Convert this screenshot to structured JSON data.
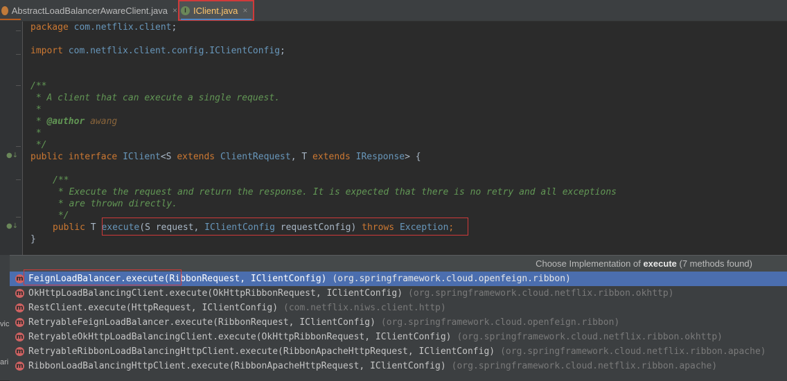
{
  "tabs": [
    {
      "label": "AbstractLoadBalancerAwareClient.java",
      "icon": "java-class-icon",
      "close": "×"
    },
    {
      "label": "IClient.java",
      "icon": "java-interface-icon",
      "icon_glyph": "I",
      "close": "×"
    }
  ],
  "code": {
    "l1_kw": "package",
    "l1_pkg": "com.netflix.client",
    "l1_end": ";",
    "l2_kw": "import",
    "l2_pkg": "com.netflix.client.config.IClientConfig",
    "l2_end": ";",
    "c1": "/**",
    "c2": " * A client that can execute a single request.",
    "c3": " *",
    "c4_star": " * ",
    "c4_tag": "@author",
    "c4_val": " awang",
    "c5": " *",
    "c6": " */",
    "i_public": "public",
    "i_interface": " interface ",
    "i_name": "IClient",
    "i_lt": "<S ",
    "i_ext1": "extends",
    "i_cr": " ClientRequest",
    "i_comma": ", T ",
    "i_ext2": "extends",
    "i_ir": " IResponse",
    "i_end": "> {",
    "d1": "/**",
    "d2": " * Execute the request and return the response. It is expected that there is no retry and all exceptions",
    "d3": " * are thrown directly.",
    "d4": " */",
    "m_public": "public",
    "m_t": " T ",
    "m_name": "execute",
    "m_paren": "(S request, ",
    "m_cfg": "IClientConfig",
    "m_rc": " requestConfig) ",
    "m_throws": "throws",
    "m_exc": " Exception",
    "m_end": ";",
    "close_brace": "}"
  },
  "popup": {
    "title_prefix": "Choose Implementation of ",
    "title_method": "execute",
    "title_suffix": " (7 methods found)",
    "items": [
      {
        "sig": "FeignLoadBalancer.execute(RibbonRequest, IClientConfig)",
        "pkg": "(org.springframework.cloud.openfeign.ribbon)",
        "selected": true
      },
      {
        "sig": "OkHttpLoadBalancingClient.execute(OkHttpRibbonRequest, IClientConfig)",
        "pkg": "(org.springframework.cloud.netflix.ribbon.okhttp)"
      },
      {
        "sig": "RestClient.execute(HttpRequest, IClientConfig)",
        "pkg": "(com.netflix.niws.client.http)"
      },
      {
        "sig": "RetryableFeignLoadBalancer.execute(RibbonRequest, IClientConfig)",
        "pkg": "(org.springframework.cloud.openfeign.ribbon)"
      },
      {
        "sig": "RetryableOkHttpLoadBalancingClient.execute(OkHttpRibbonRequest, IClientConfig)",
        "pkg": "(org.springframework.cloud.netflix.ribbon.okhttp)"
      },
      {
        "sig": "RetryableRibbonLoadBalancingHttpClient.execute(RibbonApacheHttpRequest, IClientConfig)",
        "pkg": "(org.springframework.cloud.netflix.ribbon.apache)"
      },
      {
        "sig": "RibbonLoadBalancingHttpClient.execute(RibbonApacheHttpRequest, IClientConfig)",
        "pkg": "(org.springframework.cloud.netflix.ribbon.apache)"
      }
    ]
  },
  "edge": {
    "t1": "vic",
    "t2": "ari"
  },
  "colors": {
    "accent": "#4b6eaf",
    "highlight": "#d03a3a",
    "method_icon": "#d06262"
  }
}
